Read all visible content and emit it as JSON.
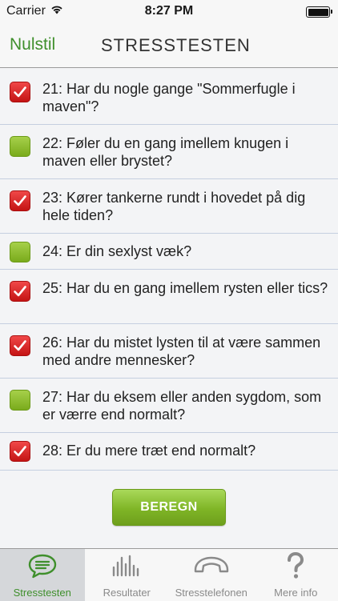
{
  "status_bar": {
    "carrier": "Carrier",
    "time": "8:27 PM"
  },
  "nav": {
    "left_button": "Nulstil",
    "title": "STRESSTESTEN"
  },
  "questions": [
    {
      "text": "21: Har du nogle gange \"Sommerfugle i maven\"?",
      "checked": true
    },
    {
      "text": "22: Føler du en gang imellem knugen i maven eller brystet?",
      "checked": false
    },
    {
      "text": "23: Kører tankerne rundt i hovedet på dig hele tiden?",
      "checked": true
    },
    {
      "text": "24: Er din sexlyst væk?",
      "checked": false
    },
    {
      "text": "25: Har du en gang imellem rysten eller tics?",
      "checked": true
    },
    {
      "text": "26: Har du mistet lysten til at være sammen med andre mennesker?",
      "checked": true
    },
    {
      "text": "27: Har du eksem eller anden sygdom, som er værre end normalt?",
      "checked": false
    },
    {
      "text": "28: Er du mere træt end normalt?",
      "checked": true
    }
  ],
  "calculate_button": "BEREGN",
  "tabs": [
    {
      "label": "Stresstesten",
      "icon": "speech-bubble-icon",
      "active": true
    },
    {
      "label": "Resultater",
      "icon": "bar-chart-icon",
      "active": false
    },
    {
      "label": "Stresstelefonen",
      "icon": "phone-icon",
      "active": false
    },
    {
      "label": "Mere info",
      "icon": "question-mark-icon",
      "active": false
    }
  ],
  "colors": {
    "accent_green": "#3f8f2c",
    "checked_red": "#d82020",
    "unchecked_green": "#8fbf2e"
  }
}
